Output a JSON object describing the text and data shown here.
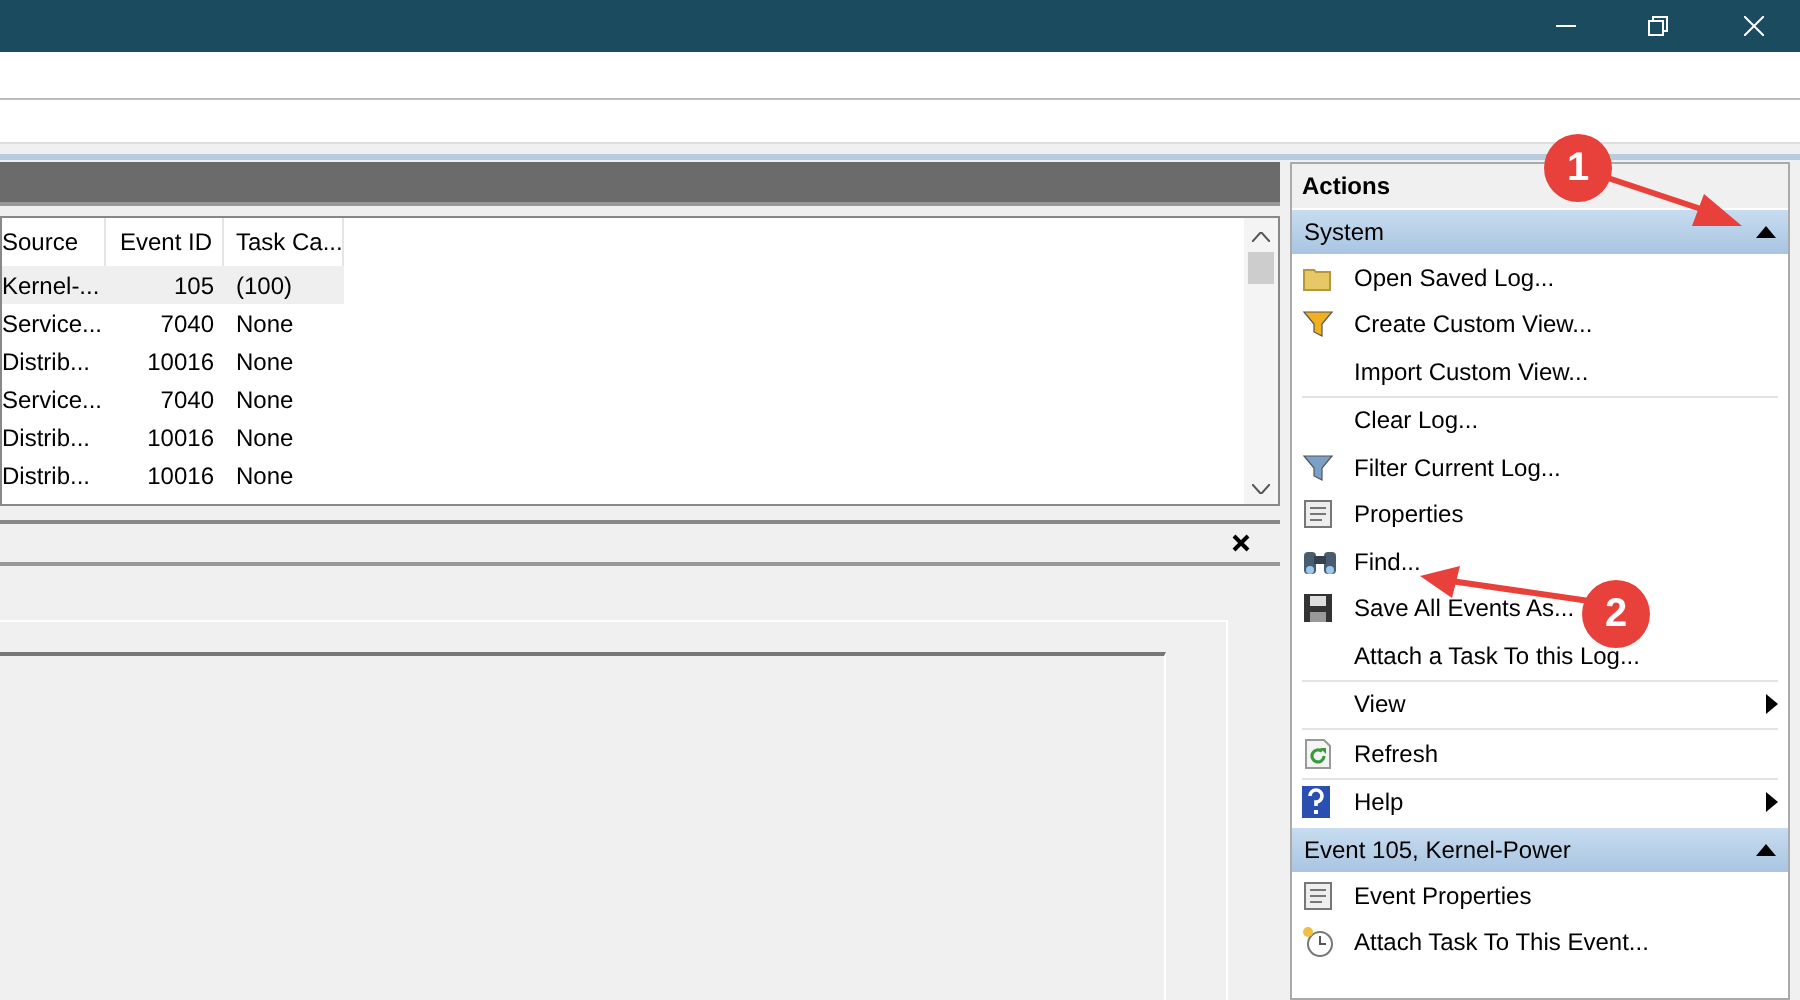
{
  "table": {
    "columns": [
      "Source",
      "Event ID",
      "Task Ca..."
    ],
    "rows": [
      {
        "cells": [
          "Kernel-...",
          "105",
          "(100)"
        ],
        "selected": true
      },
      {
        "cells": [
          "Service...",
          "7040",
          "None"
        ],
        "selected": false
      },
      {
        "cells": [
          "Distrib...",
          "10016",
          "None"
        ],
        "selected": false
      },
      {
        "cells": [
          "Service...",
          "7040",
          "None"
        ],
        "selected": false
      },
      {
        "cells": [
          "Distrib...",
          "10016",
          "None"
        ],
        "selected": false
      },
      {
        "cells": [
          "Distrib...",
          "10016",
          "None"
        ],
        "selected": false
      }
    ]
  },
  "actions": {
    "title": "Actions",
    "sections": [
      {
        "title": "System",
        "expanded": true,
        "items": [
          {
            "label": "Open Saved Log...",
            "separator_above": false,
            "submenu": false
          },
          {
            "label": "Create Custom View...",
            "separator_above": false,
            "submenu": false
          },
          {
            "label": "Import Custom View...",
            "separator_above": false,
            "submenu": false
          },
          {
            "label": "Clear Log...",
            "separator_above": true,
            "submenu": false
          },
          {
            "label": "Filter Current Log...",
            "separator_above": false,
            "submenu": false
          },
          {
            "label": "Properties",
            "separator_above": false,
            "submenu": false
          },
          {
            "label": "Find...",
            "separator_above": false,
            "submenu": false
          },
          {
            "label": "Save All Events As...",
            "separator_above": false,
            "submenu": false
          },
          {
            "label": "Attach a Task To this Log...",
            "separator_above": false,
            "submenu": false
          },
          {
            "label": "View",
            "separator_above": true,
            "submenu": true
          },
          {
            "label": "Refresh",
            "separator_above": true,
            "submenu": false
          },
          {
            "label": "Help",
            "separator_above": true,
            "submenu": true
          }
        ]
      },
      {
        "title": "Event 105, Kernel-Power",
        "expanded": true,
        "items": [
          {
            "label": "Event Properties",
            "separator_above": false,
            "submenu": false
          },
          {
            "label": "Attach Task To This Event...",
            "separator_above": false,
            "submenu": false
          }
        ]
      }
    ]
  },
  "annotations": [
    {
      "label": "1"
    },
    {
      "label": "2"
    }
  ]
}
